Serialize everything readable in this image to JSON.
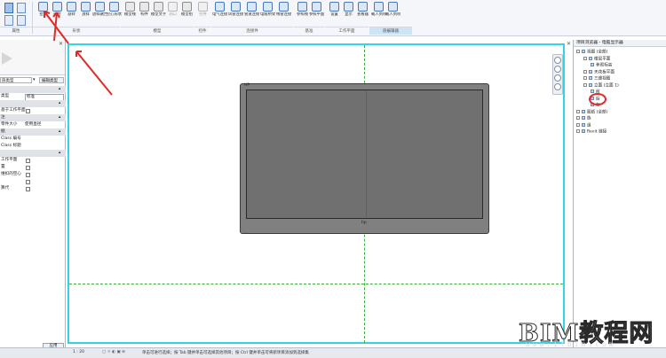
{
  "ribbon": {
    "groups": [
      {
        "label": "属性"
      },
      {
        "label": "形状"
      },
      {
        "label": "模型"
      },
      {
        "label": "控件"
      },
      {
        "label": "连接件"
      },
      {
        "label": "基准"
      },
      {
        "label": "工作平面"
      },
      {
        "label": "族编辑器"
      }
    ],
    "tools": [
      {
        "label": "拉伸"
      },
      {
        "label": "融合"
      },
      {
        "label": "旋转"
      },
      {
        "label": "放样"
      },
      {
        "label": "放样融合"
      },
      {
        "label": "空心形状"
      },
      {
        "label": "模型线"
      },
      {
        "label": "构件"
      },
      {
        "label": "模型文字"
      },
      {
        "label": "洞口"
      },
      {
        "label": "模型组"
      },
      {
        "label": "控件"
      },
      {
        "label": "电气连接件"
      },
      {
        "label": "风管连接件"
      },
      {
        "label": "管道连接件"
      },
      {
        "label": "电缆桥架连接件"
      },
      {
        "label": "线管连接件"
      },
      {
        "label": "参照线"
      },
      {
        "label": "参照平面"
      },
      {
        "label": "设置"
      },
      {
        "label": "显示"
      },
      {
        "label": "查看器"
      },
      {
        "label": "载入到项目"
      },
      {
        "label": "载入到项目并关闭"
      }
    ]
  },
  "properties": {
    "type_selector": "族类型",
    "edit_type": "编辑类型",
    "rows": [
      {
        "label": "",
        "value": "",
        "kind": "cat"
      },
      {
        "label": "类型",
        "value": "标准",
        "kind": "field"
      },
      {
        "label": "",
        "value": "",
        "kind": "cat"
      },
      {
        "label": "基于工作平面",
        "value": "",
        "kind": "check"
      },
      {
        "label": "注",
        "value": "",
        "kind": "cat"
      },
      {
        "label": "零件大小",
        "value": "使用直径",
        "kind": "field"
      },
      {
        "label": "据",
        "value": "",
        "kind": "cat"
      },
      {
        "label": "Class 编号",
        "value": "",
        "kind": "text"
      },
      {
        "label": "Class 标题",
        "value": "",
        "kind": "text"
      },
      {
        "label": "",
        "value": "",
        "kind": "cat"
      },
      {
        "label": "工作平面",
        "value": "",
        "kind": "check"
      },
      {
        "label": "置",
        "value": "",
        "kind": "check"
      },
      {
        "label": "维扣的空心",
        "value": "",
        "kind": "check"
      },
      {
        "label": "",
        "value": "",
        "kind": "check"
      },
      {
        "label": "算代",
        "value": "",
        "kind": "check"
      }
    ],
    "apply_label": "应用"
  },
  "canvas": {
    "corner_mark": "HP",
    "logo_mark": "hp"
  },
  "project_browser": {
    "title": "项目浏览器 - 电脑显示器",
    "nodes": [
      {
        "text": "视图 (全部)",
        "level": 0
      },
      {
        "text": "楼层平面",
        "level": 1
      },
      {
        "text": "参照标高",
        "level": 2
      },
      {
        "text": "天花板平面",
        "level": 1
      },
      {
        "text": "三维视图",
        "level": 1
      },
      {
        "text": "立面 (立面 1)",
        "level": 1
      },
      {
        "text": "前",
        "level": 2
      },
      {
        "text": "后",
        "level": 2
      },
      {
        "text": "左",
        "level": 2
      },
      {
        "text": "图纸 (全部)",
        "level": 0
      },
      {
        "text": "族",
        "level": 0
      },
      {
        "text": "组",
        "level": 0
      },
      {
        "text": "Revit 链接",
        "level": 0
      }
    ]
  },
  "status_bar": {
    "scale": "1 : 20",
    "hint": "单击可进行选择；按 Tab 键并单击可选择其他项目；按 Ctrl 键并单击可将新项目添加到选择集"
  },
  "watermark": {
    "main": "BIM教程网",
    "url": "www.ifbim.com"
  },
  "colors": {
    "view_border": "#34d3e6",
    "annotation_red": "#e02a2a",
    "guide_green": "#3cab3c",
    "monitor_body": "#808080"
  }
}
